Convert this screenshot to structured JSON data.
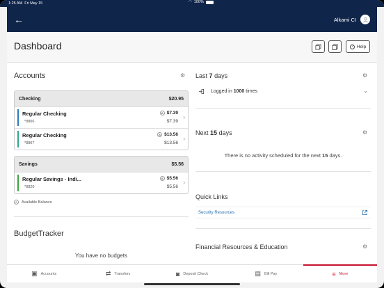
{
  "status": {
    "time": "1:25 AM",
    "date": "Fri May 15",
    "battery": "100%"
  },
  "header": {
    "user_name": "Alkami CI"
  },
  "page": {
    "title": "Dashboard",
    "help_label": "Help"
  },
  "accounts": {
    "title": "Accounts",
    "groups": [
      {
        "name": "Checking",
        "total": "$20.95",
        "items": [
          {
            "name": "Regular Checking",
            "number": "*8806",
            "available": "$7.39",
            "current": "$7.39",
            "color": "#2a7ac0"
          },
          {
            "name": "Regular Checking",
            "number": "*8807",
            "available": "$13.56",
            "current": "$13.56",
            "color": "#2aa88a"
          }
        ]
      },
      {
        "name": "Savings",
        "total": "$5.56",
        "items": [
          {
            "name": "Regular Savings - Indi...",
            "number": "*8820",
            "available": "$5.56",
            "current": "$5.56",
            "color": "#3aa63a"
          }
        ]
      }
    ],
    "legend": "Available Balance"
  },
  "budget": {
    "title": "BudgetTracker",
    "empty": "You have no budgets"
  },
  "last_days": {
    "prefix": "Last",
    "days": "7",
    "suffix": "days",
    "login_pre": "Logged in",
    "count": "1000",
    "login_post": "times"
  },
  "next_days": {
    "prefix": "Next",
    "days": "15",
    "suffix": "days",
    "empty_pre": "There is no activity scheduled for the next",
    "empty_days": "15",
    "empty_post": "days."
  },
  "quick_links": {
    "title": "Quick Links",
    "items": [
      "Security Resources"
    ]
  },
  "financial": {
    "title": "Financial Resources & Education"
  },
  "tabs": [
    {
      "label": "Accounts",
      "icon": "accounts-icon"
    },
    {
      "label": "Transfers",
      "icon": "transfers-icon"
    },
    {
      "label": "Deposit Check",
      "icon": "camera-icon"
    },
    {
      "label": "Bill Pay",
      "icon": "bill-icon"
    },
    {
      "label": "More",
      "icon": "menu-icon"
    }
  ],
  "colors": {
    "navy": "#10254a",
    "accent": "#c8102e",
    "link": "#2a6fb0"
  }
}
